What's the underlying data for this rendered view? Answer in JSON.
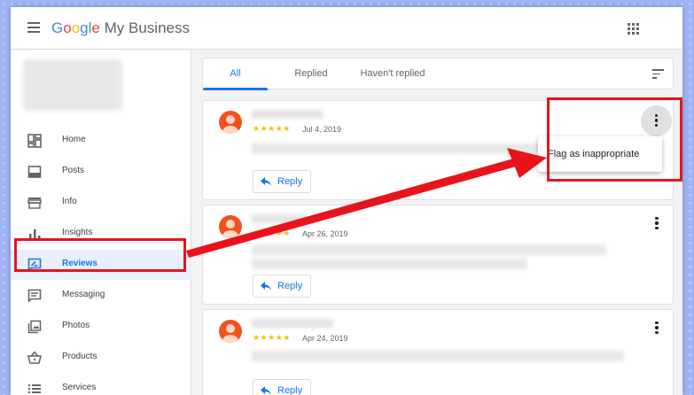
{
  "header": {
    "menu_icon": "hamburger-menu-icon",
    "brand": {
      "letters": [
        {
          "char": "G",
          "color": "#4285F4"
        },
        {
          "char": "o",
          "color": "#EA4335"
        },
        {
          "char": "o",
          "color": "#FBBC05"
        },
        {
          "char": "g",
          "color": "#4285F4"
        },
        {
          "char": "l",
          "color": "#34A853"
        },
        {
          "char": "e",
          "color": "#EA4335"
        }
      ],
      "rest": " My Business"
    },
    "apps_icon": "apps-grid-icon"
  },
  "sidebar": {
    "items": [
      {
        "label": "Home",
        "icon": "dashboard-icon",
        "active": false
      },
      {
        "label": "Posts",
        "icon": "posts-icon",
        "active": false
      },
      {
        "label": "Info",
        "icon": "storefront-icon",
        "active": false
      },
      {
        "label": "Insights",
        "icon": "bar-chart-icon",
        "active": false
      },
      {
        "label": "Reviews",
        "icon": "rate-review-icon",
        "active": true
      },
      {
        "label": "Messaging",
        "icon": "message-icon",
        "active": false
      },
      {
        "label": "Photos",
        "icon": "photo-library-icon",
        "active": false
      },
      {
        "label": "Products",
        "icon": "shopping-basket-icon",
        "active": false
      },
      {
        "label": "Services",
        "icon": "list-icon",
        "active": false
      }
    ]
  },
  "tabs": [
    {
      "label": "All",
      "active": true
    },
    {
      "label": "Replied",
      "active": false
    },
    {
      "label": "Haven't replied",
      "active": false
    }
  ],
  "sort_icon": "sort-icon",
  "reviews": [
    {
      "stars": "★★★★★",
      "rating": 5,
      "date": "Jul 4, 2019",
      "reply_label": "Reply"
    },
    {
      "stars": "★★★★★",
      "rating": 5,
      "date": "Apr 26, 2019",
      "reply_label": "Reply"
    },
    {
      "stars": "★★★★★",
      "rating": 5,
      "date": "Apr 24, 2019",
      "reply_label": "Reply"
    }
  ],
  "overflow_menu": {
    "items": [
      "Flag as inappropriate"
    ]
  },
  "colors": {
    "accent": "#1a73e8",
    "star": "#fbbc04",
    "avatar": "#f4511e",
    "annotation": "#e8131b"
  }
}
